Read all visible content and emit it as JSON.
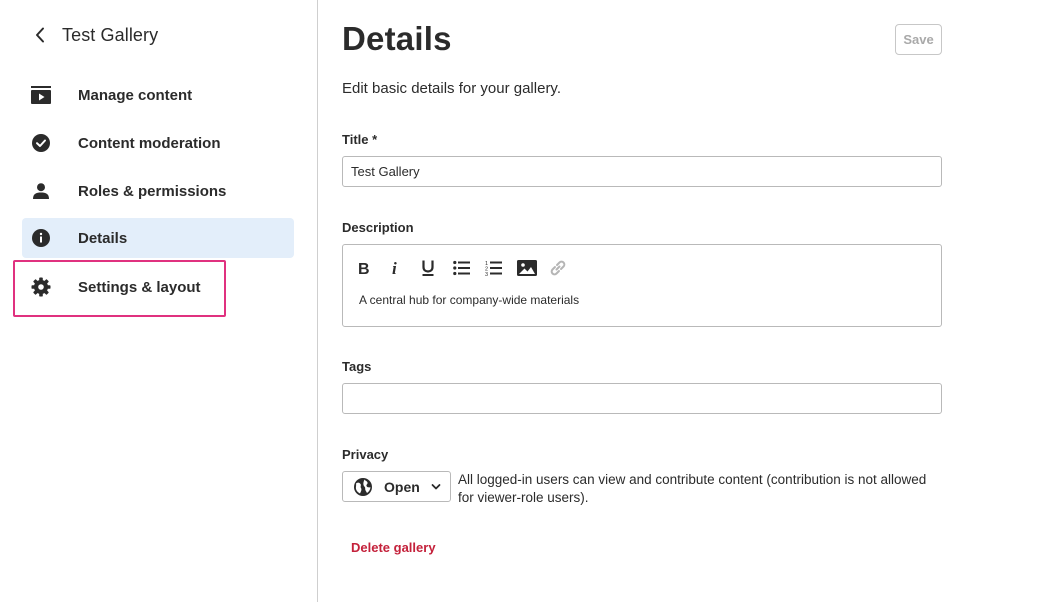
{
  "sidebar": {
    "back_title": "Test Gallery",
    "items": [
      {
        "label": "Manage content",
        "icon": "play-box-icon"
      },
      {
        "label": "Content moderation",
        "icon": "check-circle-icon"
      },
      {
        "label": "Roles & permissions",
        "icon": "person-icon"
      },
      {
        "label": "Details",
        "icon": "info-icon",
        "active": true
      },
      {
        "label": "Settings & layout",
        "icon": "gear-icon",
        "highlighted": true
      }
    ]
  },
  "main": {
    "title": "Details",
    "save_label": "Save",
    "subtitle": "Edit basic details for your gallery.",
    "title_field": {
      "label": "Title *",
      "value": "Test Gallery"
    },
    "description": {
      "label": "Description",
      "toolbar": [
        "bold-icon",
        "italic-icon",
        "underline-icon",
        "bulleted-list-icon",
        "numbered-list-icon",
        "image-icon",
        "link-icon"
      ],
      "text": "A central hub for company-wide materials"
    },
    "tags": {
      "label": "Tags",
      "value": ""
    },
    "privacy": {
      "label": "Privacy",
      "value": "Open",
      "description": "All logged-in users can view and contribute content (contribution is not allowed for viewer-role users)."
    },
    "delete_label": "Delete gallery"
  },
  "colors": {
    "active_bg": "#e3eefa",
    "highlight_border": "#e0317f",
    "delete": "#c4213b",
    "text": "#2b2b2b"
  }
}
